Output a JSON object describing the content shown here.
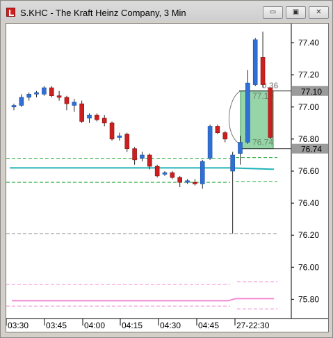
{
  "window": {
    "title": "S.KHC - The Kraft Heinz Company, 3 Min",
    "icon": "chart-app-icon",
    "buttons": [
      {
        "name": "minimize",
        "glyph": "▭"
      },
      {
        "name": "restore",
        "glyph": "▣"
      },
      {
        "name": "close",
        "glyph": "✕"
      }
    ]
  },
  "chart_data": {
    "type": "candlestick",
    "symbol": "S.KHC",
    "ylim": [
      75.68,
      77.52
    ],
    "y_ticks": [
      "77.40",
      "77.20",
      "77.00",
      "76.80",
      "76.60",
      "76.40",
      "76.20",
      "76.00",
      "75.80"
    ],
    "x_ticks": [
      "03:30",
      "03:45",
      "04:00",
      "04:15",
      "04:30",
      "04:45",
      "27-22:30"
    ],
    "price_tags": [
      {
        "label": "77.10",
        "value": 77.1
      },
      {
        "label": "76.74",
        "value": 76.74
      }
    ],
    "candles": [
      {
        "o": 77.0,
        "h": 77.02,
        "l": 76.98,
        "c": 77.01
      },
      {
        "o": 77.01,
        "h": 77.08,
        "l": 77.0,
        "c": 77.06
      },
      {
        "o": 77.06,
        "h": 77.09,
        "l": 77.04,
        "c": 77.08
      },
      {
        "o": 77.08,
        "h": 77.1,
        "l": 77.06,
        "c": 77.09
      },
      {
        "o": 77.08,
        "h": 77.13,
        "l": 77.07,
        "c": 77.12
      },
      {
        "o": 77.12,
        "h": 77.13,
        "l": 77.06,
        "c": 77.07
      },
      {
        "o": 77.07,
        "h": 77.1,
        "l": 77.04,
        "c": 77.06
      },
      {
        "o": 77.06,
        "h": 77.07,
        "l": 76.98,
        "c": 77.02
      },
      {
        "o": 77.01,
        "h": 77.05,
        "l": 76.97,
        "c": 77.03
      },
      {
        "o": 77.02,
        "h": 77.04,
        "l": 76.9,
        "c": 76.91
      },
      {
        "o": 76.93,
        "h": 76.96,
        "l": 76.9,
        "c": 76.95
      },
      {
        "o": 76.95,
        "h": 76.96,
        "l": 76.91,
        "c": 76.92
      },
      {
        "o": 76.93,
        "h": 76.95,
        "l": 76.88,
        "c": 76.9
      },
      {
        "o": 76.9,
        "h": 76.91,
        "l": 76.79,
        "c": 76.8
      },
      {
        "o": 76.81,
        "h": 76.84,
        "l": 76.79,
        "c": 76.82
      },
      {
        "o": 76.83,
        "h": 76.84,
        "l": 76.72,
        "c": 76.74
      },
      {
        "o": 76.74,
        "h": 76.75,
        "l": 76.64,
        "c": 76.67
      },
      {
        "o": 76.68,
        "h": 76.72,
        "l": 76.66,
        "c": 76.7
      },
      {
        "o": 76.7,
        "h": 76.71,
        "l": 76.61,
        "c": 76.63
      },
      {
        "o": 76.63,
        "h": 76.64,
        "l": 76.56,
        "c": 76.57
      },
      {
        "o": 76.58,
        "h": 76.6,
        "l": 76.57,
        "c": 76.59
      },
      {
        "o": 76.59,
        "h": 76.6,
        "l": 76.55,
        "c": 76.56
      },
      {
        "o": 76.56,
        "h": 76.57,
        "l": 76.5,
        "c": 76.53
      },
      {
        "o": 76.53,
        "h": 76.55,
        "l": 76.52,
        "c": 76.54
      },
      {
        "o": 76.53,
        "h": 76.55,
        "l": 76.51,
        "c": 76.52
      },
      {
        "o": 76.52,
        "h": 76.67,
        "l": 76.49,
        "c": 76.66
      },
      {
        "o": 76.68,
        "h": 76.89,
        "l": 76.67,
        "c": 76.88
      },
      {
        "o": 76.88,
        "h": 76.89,
        "l": 76.83,
        "c": 76.84
      },
      {
        "o": 76.84,
        "h": 76.85,
        "l": 76.78,
        "c": 76.8
      },
      {
        "o": 76.6,
        "h": 76.72,
        "l": 76.21,
        "c": 76.7
      },
      {
        "o": 76.71,
        "h": 76.82,
        "l": 76.64,
        "c": 76.78
      },
      {
        "o": 76.78,
        "h": 77.23,
        "l": 76.77,
        "c": 77.15
      },
      {
        "o": 77.14,
        "h": 77.43,
        "l": 77.13,
        "c": 77.42
      },
      {
        "o": 77.31,
        "h": 77.47,
        "l": 77.12,
        "c": 77.14
      },
      {
        "o": 77.12,
        "h": 77.12,
        "l": 76.8,
        "c": 76.81
      }
    ],
    "overlays": {
      "upper_band_green": 76.68,
      "middle_line_teal": 76.62,
      "lower_band_green": 76.53,
      "support_gray": 76.21,
      "pink_top": 75.91,
      "pink_mid": 75.8,
      "pink_bottom": 75.74
    },
    "position_box": {
      "top_label": "77.10",
      "bottom_label": "76.74",
      "pnl_label": "0.36",
      "top_price": 77.1,
      "bottom_price": 76.74,
      "color": "#5cbf7a"
    },
    "colors": {
      "up": "#2f6fd6",
      "down": "#cc1f1f",
      "teal": "#20b2b8",
      "green_dash": "#22a73a",
      "pink": "#f28ad0",
      "gray_dash": "#999999"
    }
  }
}
